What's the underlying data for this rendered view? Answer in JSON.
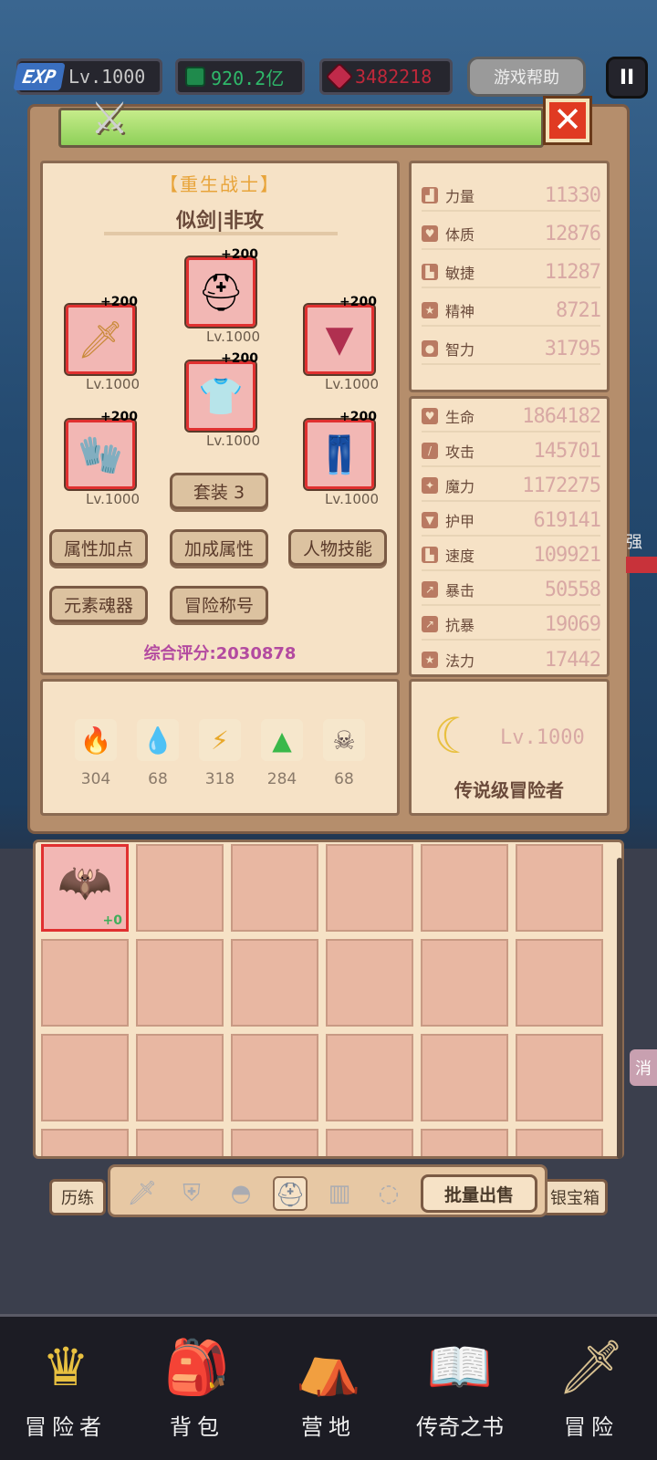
{
  "topbar": {
    "exp_badge": "EXP",
    "level": "Lv.1000",
    "gems": "920.2亿",
    "rubies": "3482218",
    "help_label": "游戏帮助",
    "pause_label": "II"
  },
  "character": {
    "class_title": "【重生战士】",
    "name": "似剑|非攻",
    "score_label": "综合评分:2030878"
  },
  "equipment": [
    {
      "slot": "helmet",
      "plus": "+200",
      "level": "Lv.1000",
      "icon": "helmet-icon"
    },
    {
      "slot": "weapon",
      "plus": "+200",
      "level": "Lv.1000",
      "icon": "sword-icon"
    },
    {
      "slot": "amulet",
      "plus": "+200",
      "level": "Lv.1000",
      "icon": "amulet-icon"
    },
    {
      "slot": "armor",
      "plus": "+200",
      "level": "Lv.1000",
      "icon": "armor-icon"
    },
    {
      "slot": "gloves",
      "plus": "+200",
      "level": "Lv.1000",
      "icon": "gloves-icon"
    },
    {
      "slot": "pants",
      "plus": "+200",
      "level": "Lv.1000",
      "icon": "pants-icon"
    }
  ],
  "buttons": {
    "set_bonus": "套装 3",
    "attr_points": "属性加点",
    "bonus_attr": "加成属性",
    "skills": "人物技能",
    "soul": "元素魂器",
    "adventure_title": "冒险称号"
  },
  "elements": [
    {
      "name": "fire",
      "value": "304"
    },
    {
      "name": "water",
      "value": "68"
    },
    {
      "name": "lightning",
      "value": "318"
    },
    {
      "name": "earth",
      "value": "284"
    },
    {
      "name": "dark",
      "value": "68"
    }
  ],
  "base_stats": [
    {
      "label": "力量",
      "value": "11330"
    },
    {
      "label": "体质",
      "value": "12876"
    },
    {
      "label": "敏捷",
      "value": "11287"
    },
    {
      "label": "精神",
      "value": "8721"
    },
    {
      "label": "智力",
      "value": "31795"
    }
  ],
  "combat_stats": [
    {
      "label": "生命",
      "value": "1864182"
    },
    {
      "label": "攻击",
      "value": "145701"
    },
    {
      "label": "魔力",
      "value": "1172275"
    },
    {
      "label": "护甲",
      "value": "619141"
    },
    {
      "label": "速度",
      "value": "109921"
    },
    {
      "label": "暴击",
      "value": "50558"
    },
    {
      "label": "抗暴",
      "value": "19069"
    },
    {
      "label": "法力",
      "value": "17442"
    }
  ],
  "rank": {
    "level": "Lv.1000",
    "title": "传说级冒险者"
  },
  "bag": {
    "first_item_plus": "+0"
  },
  "tabs": {
    "left_label": "历练",
    "right_label": "银宝箱",
    "bulk_sell": "批量出售"
  },
  "nav": [
    {
      "label": "冒险者",
      "icon": "crown-icon"
    },
    {
      "label": "背包",
      "icon": "backpack-icon"
    },
    {
      "label": "营地",
      "icon": "camp-icon"
    },
    {
      "label": "传奇之书",
      "icon": "book-icon"
    },
    {
      "label": "冒险",
      "icon": "sword-icon"
    }
  ],
  "side_deco": {
    "right_text": "强",
    "cancel_text": "消"
  }
}
